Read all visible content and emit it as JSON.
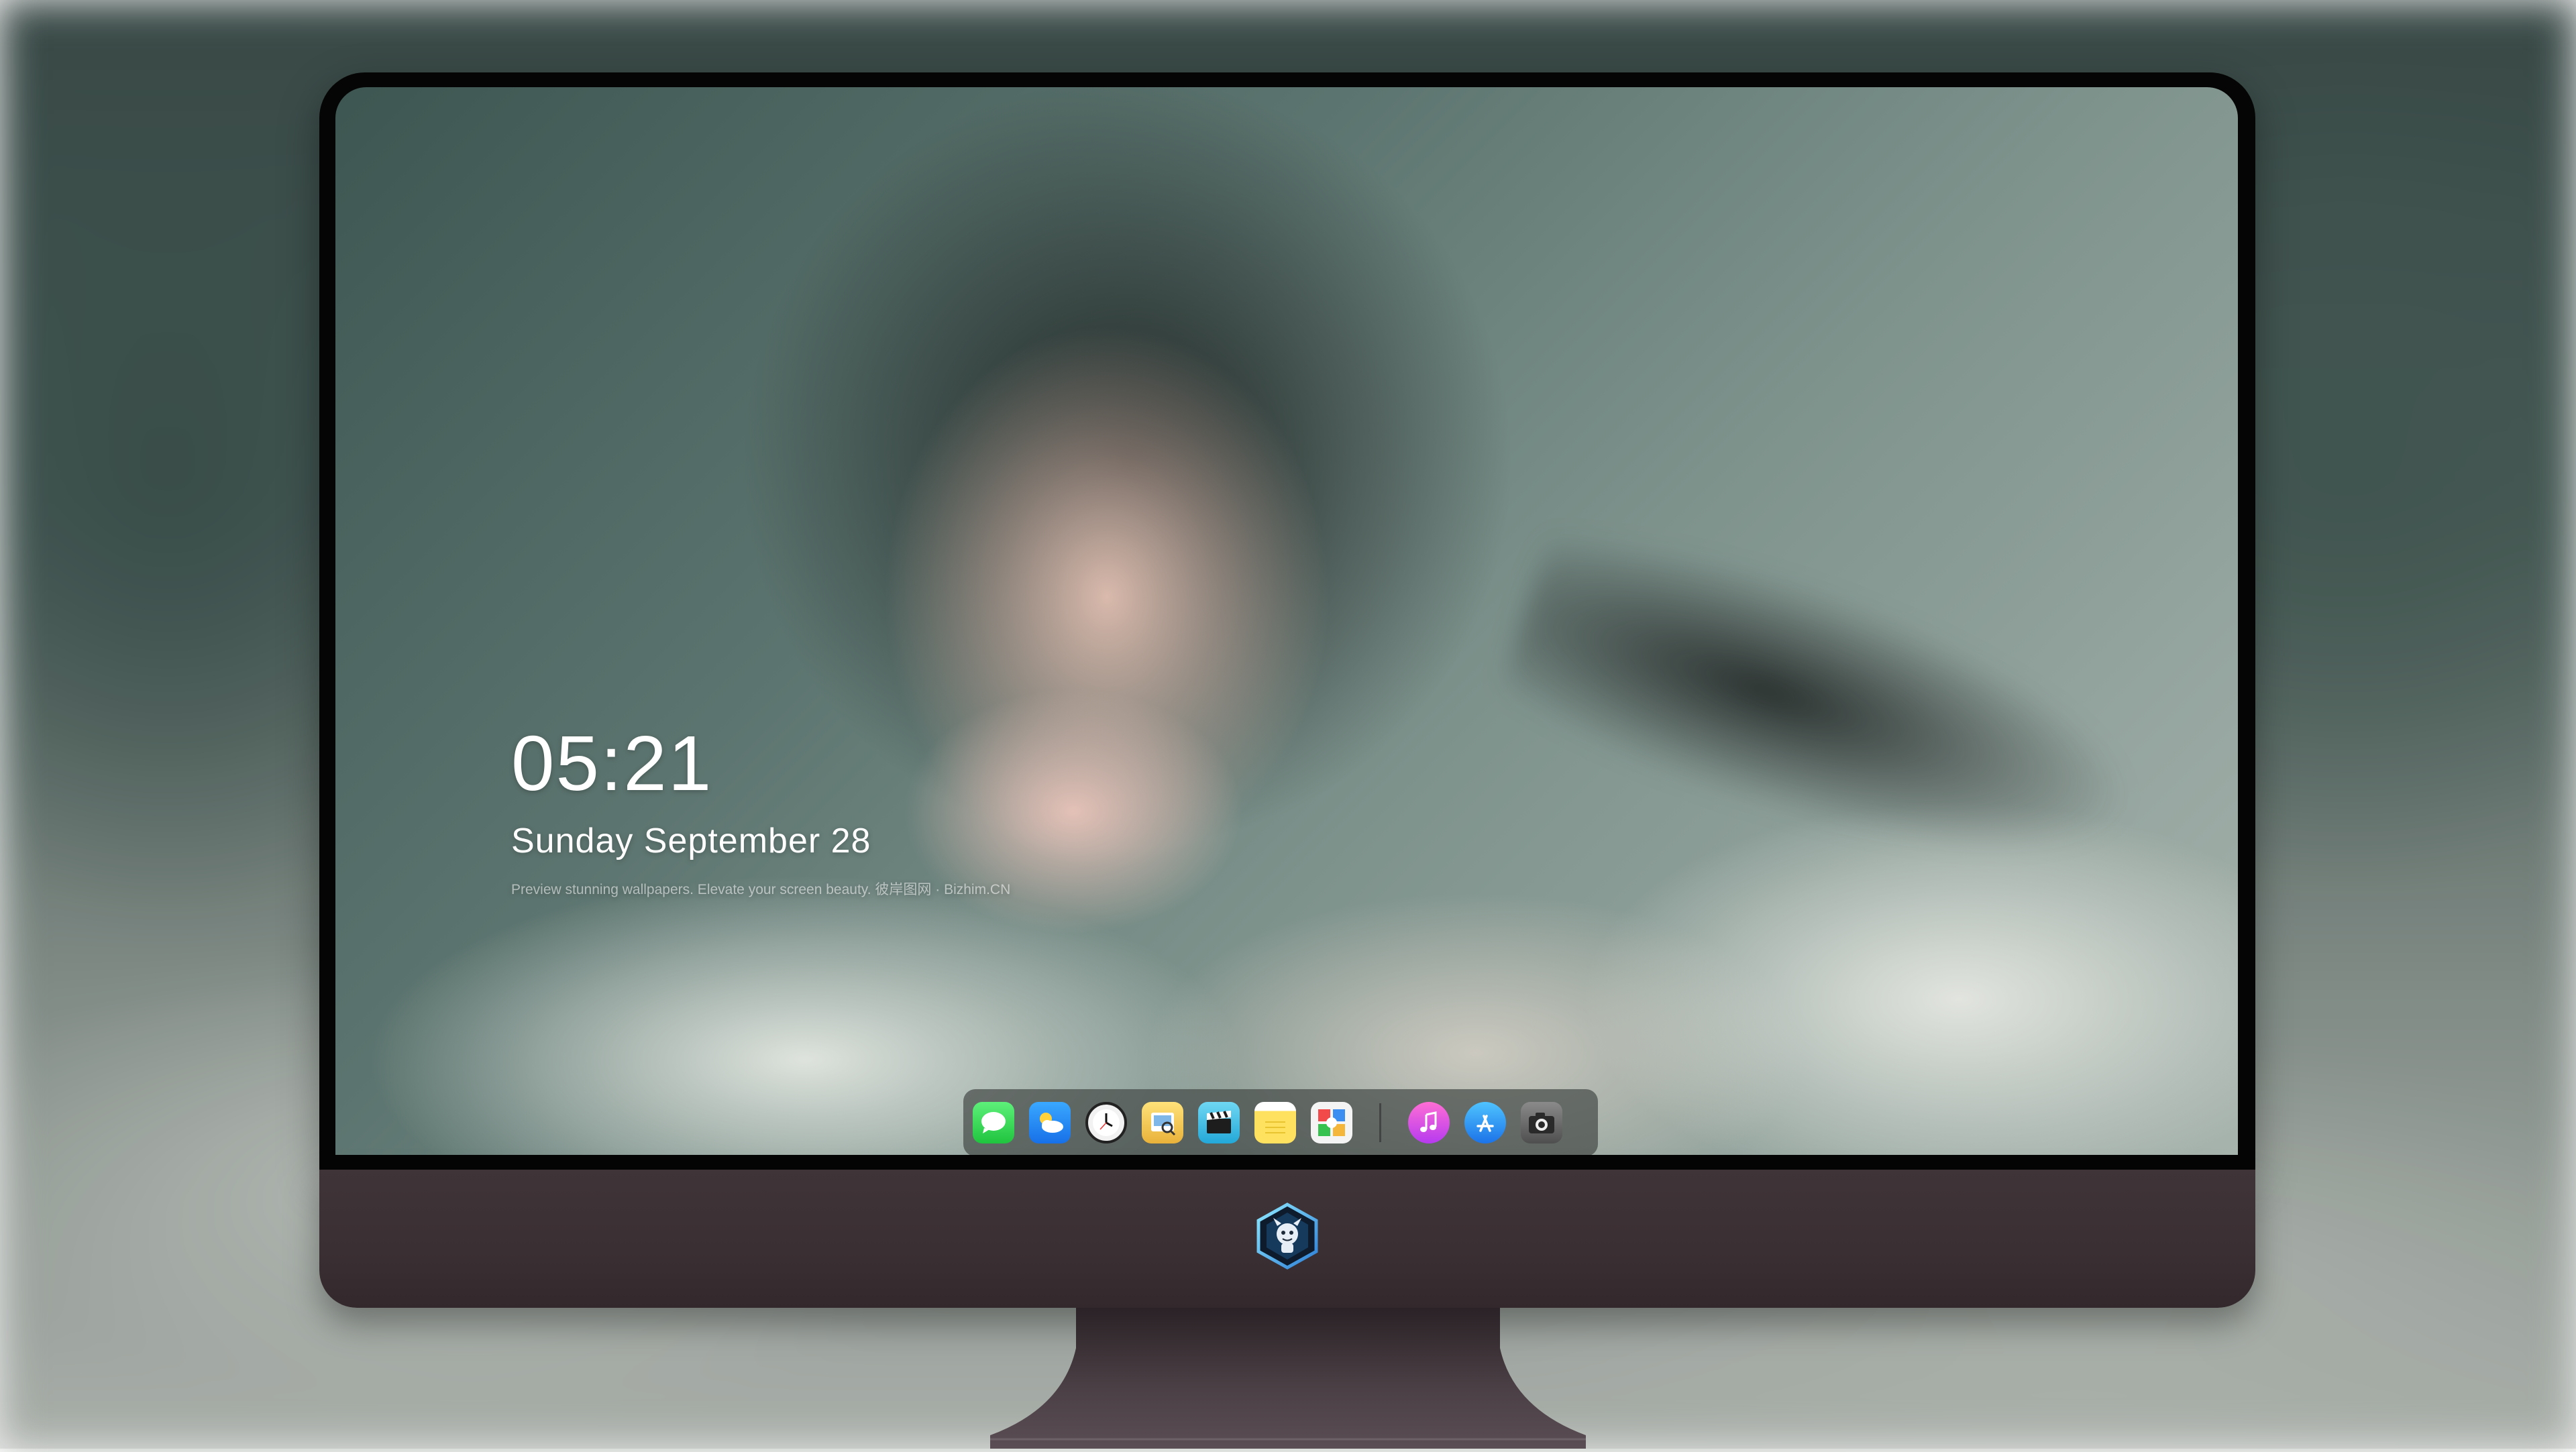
{
  "lock_screen": {
    "time": "05:21",
    "date": "Sunday September  28",
    "caption": "Preview stunning wallpapers. Elevate your screen beauty. 彼岸图网 · Bizhim.CN"
  },
  "dock": {
    "items": [
      {
        "name": "Messages",
        "icon": "messages-icon"
      },
      {
        "name": "Weather",
        "icon": "weather-icon"
      },
      {
        "name": "Clock",
        "icon": "clock-icon"
      },
      {
        "name": "Preview",
        "icon": "preview-icon"
      },
      {
        "name": "Clips",
        "icon": "clips-icon"
      },
      {
        "name": "Notes",
        "icon": "notes-icon"
      },
      {
        "name": "Photo Booth",
        "icon": "photos-icon"
      },
      {
        "name": "Music",
        "icon": "music-icon"
      },
      {
        "name": "App Store",
        "icon": "app-store-icon"
      },
      {
        "name": "Camera",
        "icon": "camera-icon"
      }
    ]
  },
  "colors": {
    "bezel": "#050505",
    "chin": "#3a2f33",
    "dock_bg": "rgba(70,76,74,0.72)",
    "clock_text": "#ffffff"
  },
  "logo": "dragon-mascot-logo"
}
